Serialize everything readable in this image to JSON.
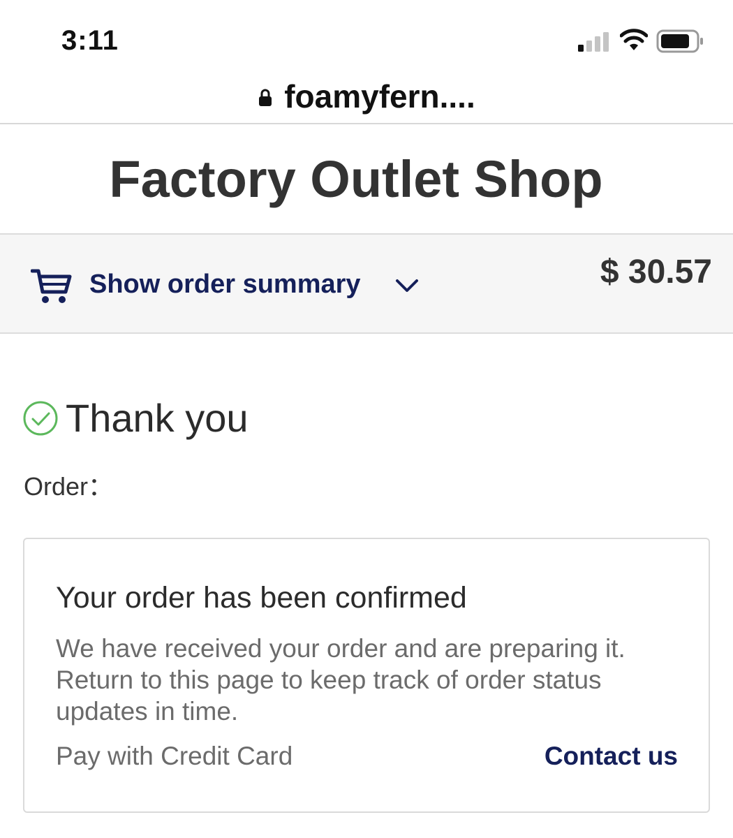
{
  "status_bar": {
    "time": "3:11",
    "icons": [
      "signal-icon",
      "wifi-icon",
      "battery-icon"
    ]
  },
  "browser": {
    "url": "foamyfern....",
    "lock_icon": "lock-icon"
  },
  "store": {
    "title": "Factory Outlet Shop"
  },
  "order_summary": {
    "toggle_label": "Show order summary",
    "total": "$ 30.57",
    "cart_icon": "cart-icon",
    "chevron_icon": "chevron-down-icon"
  },
  "thank_you": {
    "title": "Thank you",
    "order_label": "Order："
  },
  "confirmation": {
    "title": "Your order has been confirmed",
    "body": "We have received your order and are preparing it. Return to this page to keep track of order status updates in time.",
    "payment_method": "Pay with Credit Card",
    "contact_label": "Contact us"
  },
  "colors": {
    "link": "#15205a",
    "success": "#5cb85c",
    "summary_bg": "#f6f6f6"
  }
}
